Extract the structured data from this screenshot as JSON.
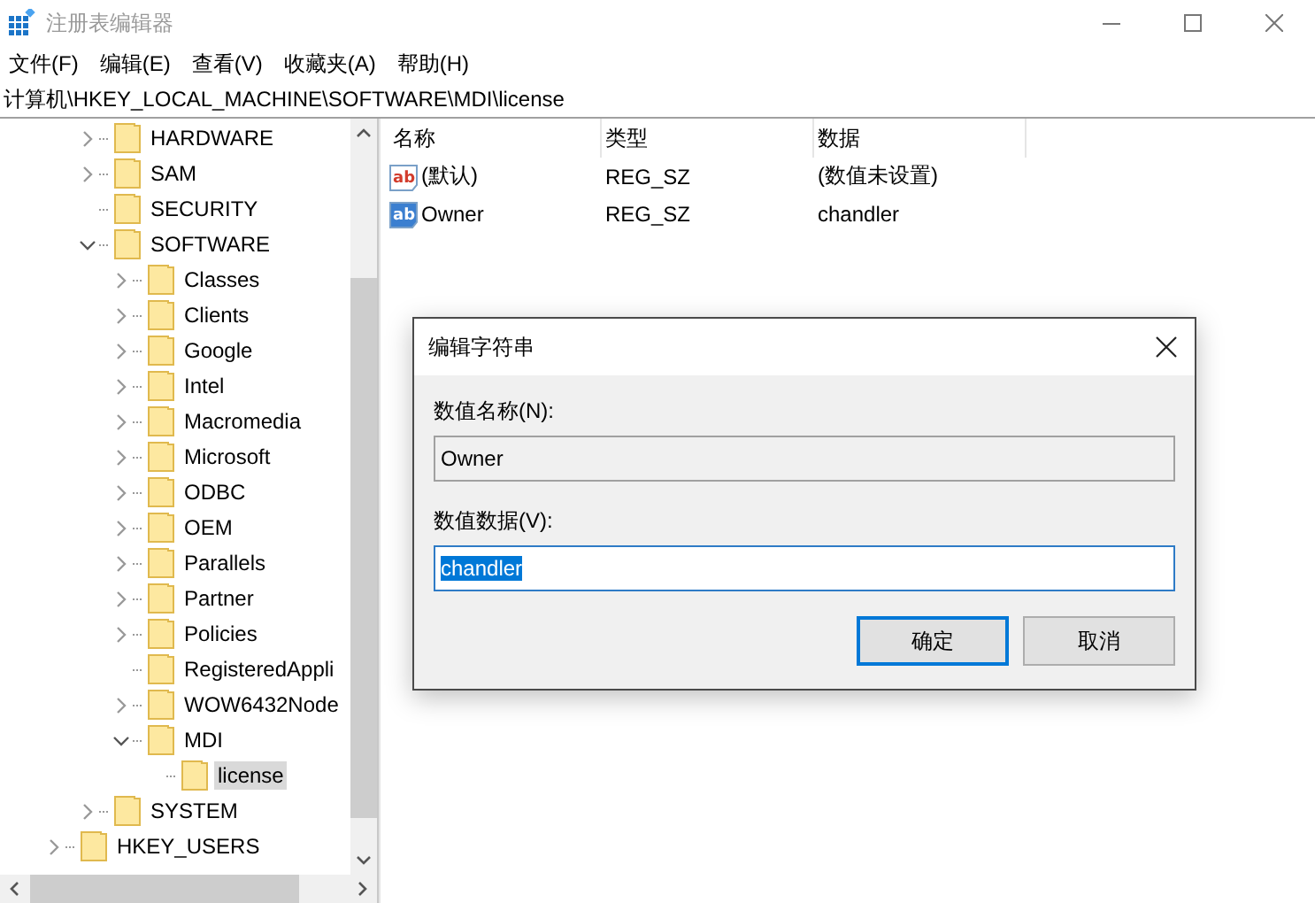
{
  "window": {
    "title": "注册表编辑器"
  },
  "menu": [
    "文件(F)",
    "编辑(E)",
    "查看(V)",
    "收藏夹(A)",
    "帮助(H)"
  ],
  "address": "计算机\\HKEY_LOCAL_MACHINE\\SOFTWARE\\MDI\\license",
  "tree": [
    {
      "children": [
        {
          "label": "HARDWARE",
          "expanded": false,
          "selected": false
        },
        {
          "label": "SAM",
          "expanded": false,
          "selected": false
        },
        {
          "label": "SECURITY",
          "selected": false
        },
        {
          "label": "SOFTWARE",
          "expanded": true,
          "selected": false,
          "children": [
            {
              "label": "Classes",
              "expanded": false,
              "selected": false
            },
            {
              "label": "Clients",
              "expanded": false,
              "selected": false
            },
            {
              "label": "Google",
              "expanded": false,
              "selected": false
            },
            {
              "label": "Intel",
              "expanded": false,
              "selected": false
            },
            {
              "label": "Macromedia",
              "expanded": false,
              "selected": false
            },
            {
              "label": "Microsoft",
              "expanded": false,
              "selected": false
            },
            {
              "label": "ODBC",
              "expanded": false,
              "selected": false
            },
            {
              "label": "OEM",
              "expanded": false,
              "selected": false
            },
            {
              "label": "Parallels",
              "expanded": false,
              "selected": false
            },
            {
              "label": "Partner",
              "expanded": false,
              "selected": false
            },
            {
              "label": "Policies",
              "expanded": false,
              "selected": false
            },
            {
              "label": "RegisteredAppli",
              "selected": false
            },
            {
              "label": "WOW6432Node",
              "expanded": false,
              "selected": false
            },
            {
              "label": "MDI",
              "expanded": true,
              "selected": false,
              "children": [
                {
                  "label": "license",
                  "selected": true
                }
              ]
            }
          ]
        },
        {
          "label": "SYSTEM",
          "expanded": false,
          "selected": false
        }
      ]
    },
    {
      "label": "HKEY_USERS",
      "expanded": false,
      "selected": false
    }
  ],
  "table": {
    "columns": [
      "名称",
      "类型",
      "数据"
    ],
    "rows": [
      {
        "icon": "ab",
        "name": "(默认)",
        "type": "REG_SZ",
        "data": "(数值未设置)",
        "selected": false
      },
      {
        "icon": "ab",
        "name": "Owner",
        "type": "REG_SZ",
        "data": "chandler",
        "selected": true
      }
    ]
  },
  "dialog": {
    "title": "编辑字符串",
    "name_label": "数值名称(N):",
    "name_value": "Owner",
    "data_label": "数值数据(V):",
    "data_value": "chandler",
    "data_value_selected": true,
    "buttons": [
      {
        "label": "确定",
        "default": true
      },
      {
        "label": "取消",
        "default": false
      }
    ]
  }
}
